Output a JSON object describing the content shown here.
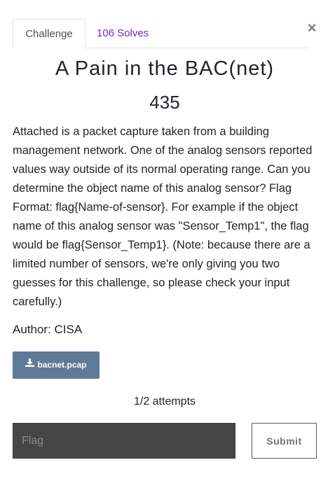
{
  "tabs": {
    "challenge_label": "Challenge",
    "solves_label": "106 Solves"
  },
  "close_label": "×",
  "challenge": {
    "title": "A Pain in the BAC(net)",
    "points": "435",
    "description": "Attached is a packet capture taken from a building management network. One of the analog sensors reported values way outside of its normal operating range. Can you determine the object name of this analog sensor? Flag Format: flag{Name-of-sensor}. For example if the object name of this analog sensor was \"Sensor_Temp1\", the flag would be flag{Sensor_Temp1}. (Note: because there are a limited number of sensors, we're only giving you two guesses for this challenge, so please check your input carefully.)",
    "author": "Author: CISA",
    "file_name": "bacnet.pcap",
    "attempts": "1/2 attempts"
  },
  "form": {
    "flag_placeholder": "Flag",
    "flag_value": "",
    "submit_label": "Submit"
  },
  "colors": {
    "accent": "#6f2bc5",
    "file_button": "#5f7a95",
    "input_background": "#464646"
  },
  "icons": {
    "close": "close-icon",
    "download": "download-icon"
  }
}
